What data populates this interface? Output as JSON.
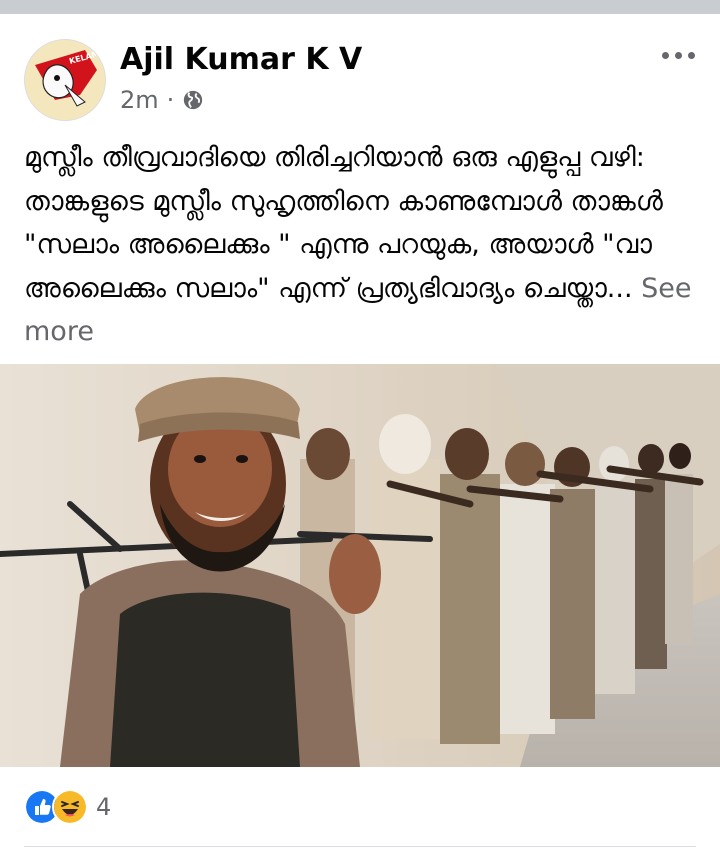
{
  "post": {
    "author": "Ajil Kumar K V",
    "time": "2m",
    "separator": "·",
    "privacy_icon": "globe-icon",
    "more_icon": "more-horizontal-icon",
    "avatar_icon": "avatar-logo",
    "avatar_text": "KELAMANDI",
    "text": "മുസ്ലീം തീവ്രവാദിയെ തിരിച്ചറിയാൻ ഒരു എളുപ്പ വഴി: താങ്കളുടെ മുസ്ലീം സുഹൃത്തിനെ കാണുമ്പോൾ താങ്കൾ \"സലാം അലൈക്കും \" എന്നു പറയുക, അയാൾ \"വാ അലൈക്കും സലാം\" എന്ന് പ്രത്യഭിവാദ്യം ചെയ്താ...",
    "see_more": "See more",
    "photo_description_icon": "photo-armed-men-row"
  },
  "reactions": {
    "icons": [
      "like-icon",
      "haha-icon"
    ],
    "count": "4"
  },
  "colors": {
    "text": "#050505",
    "secondary": "#65676b",
    "divider": "#c9ccd1",
    "like_blue": "#1877f2",
    "haha_yellow": "#f7b928"
  }
}
